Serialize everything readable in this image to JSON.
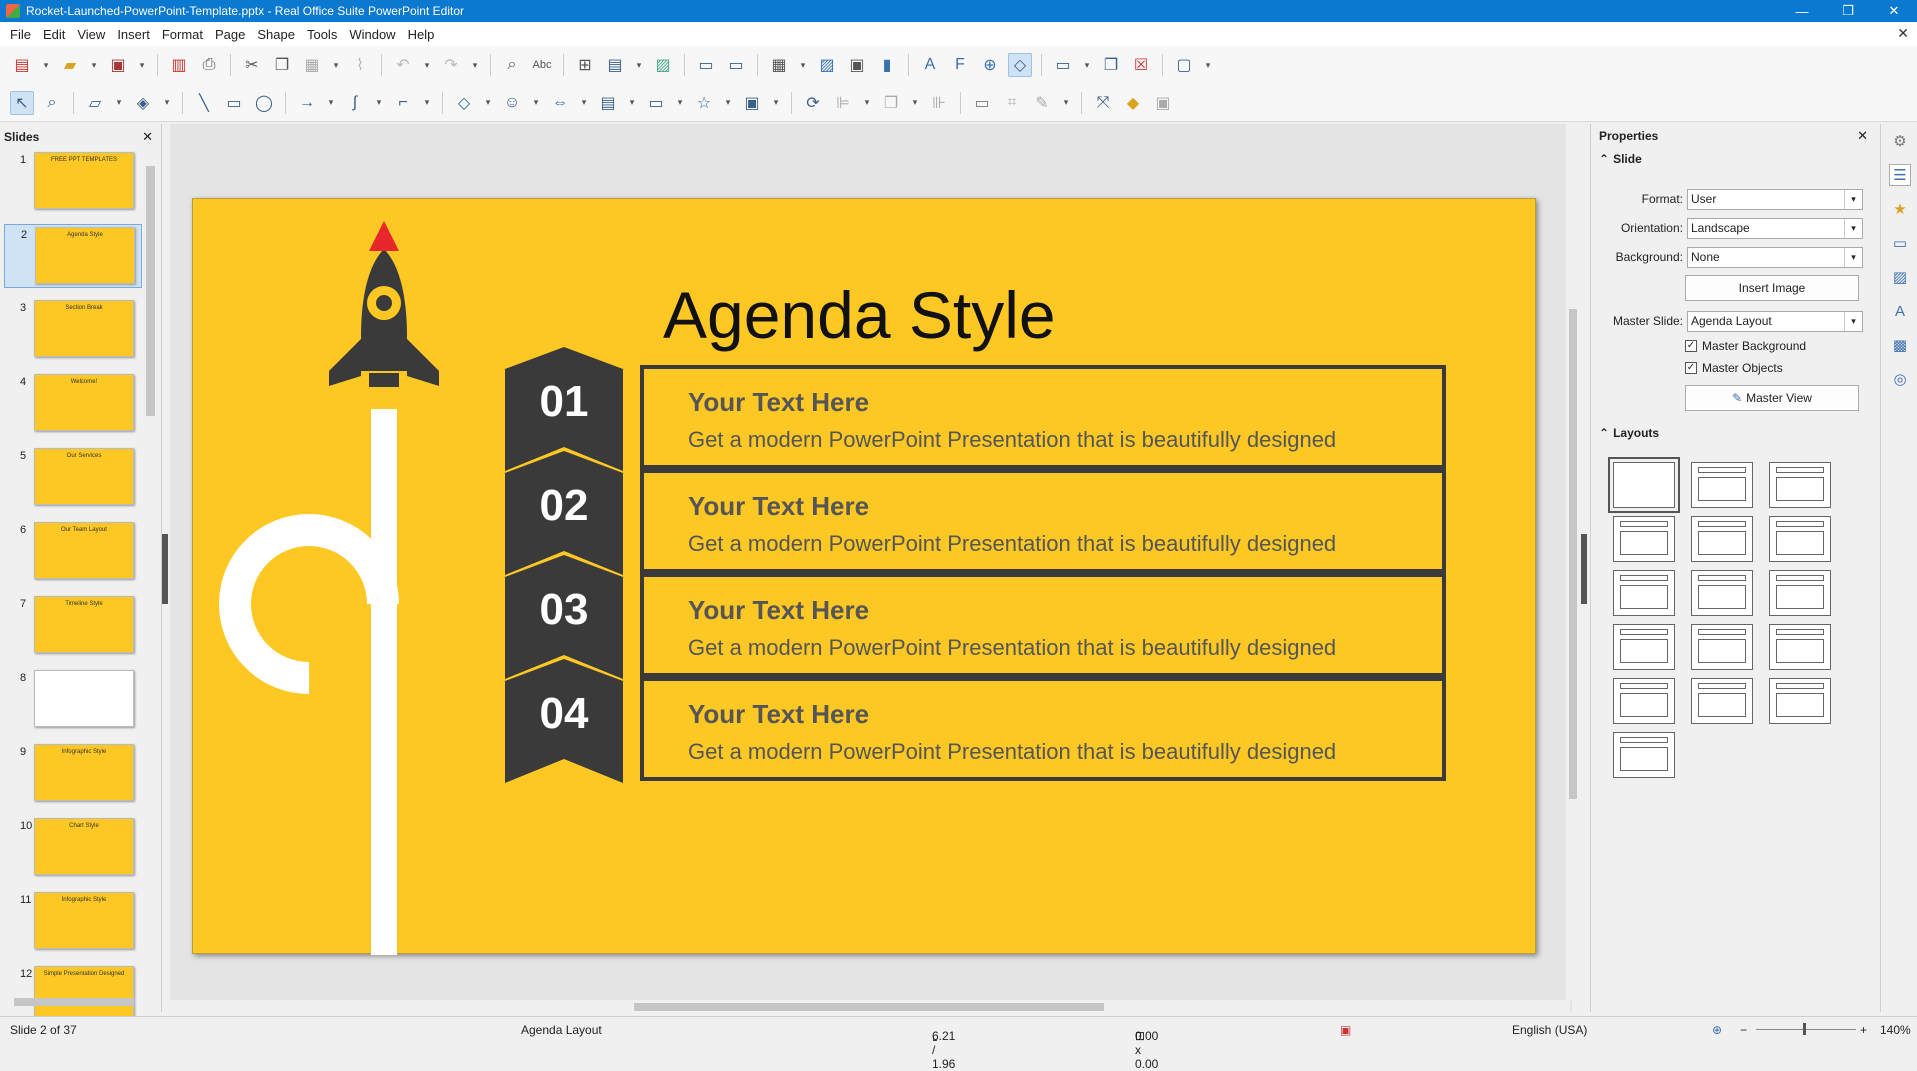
{
  "window": {
    "title": "Rocket-Launched-PowerPoint-Template.pptx - Real Office Suite PowerPoint Editor",
    "minimize": "—",
    "maximize": "❐",
    "close": "✕"
  },
  "menu": [
    "File",
    "Edit",
    "View",
    "Insert",
    "Format",
    "Page",
    "Shape",
    "Tools",
    "Window",
    "Help"
  ],
  "slides_panel": {
    "title": "Slides",
    "close": "✕",
    "items": [
      {
        "num": "1",
        "caption": "FREE PPT TEMPLATES"
      },
      {
        "num": "2",
        "caption": "Agenda Style"
      },
      {
        "num": "3",
        "caption": "Section Break"
      },
      {
        "num": "4",
        "caption": "Welcome!"
      },
      {
        "num": "5",
        "caption": "Our Services"
      },
      {
        "num": "6",
        "caption": "Our Team Layout"
      },
      {
        "num": "7",
        "caption": "Timeline Style"
      },
      {
        "num": "8",
        "caption": ""
      },
      {
        "num": "9",
        "caption": "Infographic Style"
      },
      {
        "num": "10",
        "caption": "Chart Style"
      },
      {
        "num": "11",
        "caption": "Infographic Style"
      },
      {
        "num": "12",
        "caption": "Simple Presentation Designed"
      }
    ]
  },
  "slide": {
    "title": "Agenda Style",
    "items": [
      {
        "num": "01",
        "heading": "Your Text Here",
        "text": "Get a modern PowerPoint  Presentation that is beautifully designed"
      },
      {
        "num": "02",
        "heading": "Your Text Here",
        "text": "Get a modern PowerPoint  Presentation that is beautifully designed"
      },
      {
        "num": "03",
        "heading": "Your Text Here",
        "text": "Get a modern PowerPoint  Presentation that is beautifully designed"
      },
      {
        "num": "04",
        "heading": "Your Text Here",
        "text": "Get a modern PowerPoint  Presentation that is beautifully designed"
      }
    ],
    "colors": {
      "background": "#fdc824",
      "dark": "#3a3a3a",
      "accent": "#e8262b",
      "white": "#ffffff"
    }
  },
  "properties": {
    "title": "Properties",
    "close": "✕",
    "slide_section": "Slide",
    "format_label": "Format:",
    "format_value": "User",
    "orientation_label": "Orientation:",
    "orientation_value": "Landscape",
    "background_label": "Background:",
    "background_value": "None",
    "insert_image": "Insert Image",
    "master_slide_label": "Master Slide:",
    "master_slide_value": "Agenda Layout",
    "master_background": "Master Background",
    "master_objects": "Master Objects",
    "master_view": "Master View",
    "layouts_section": "Layouts"
  },
  "status": {
    "slide_pos": "Slide 2 of 37",
    "layout": "Agenda Layout",
    "position": "6.21 / 1.96",
    "size": "0.00 x 0.00",
    "language": "English (USA)",
    "zoom": "140%"
  }
}
